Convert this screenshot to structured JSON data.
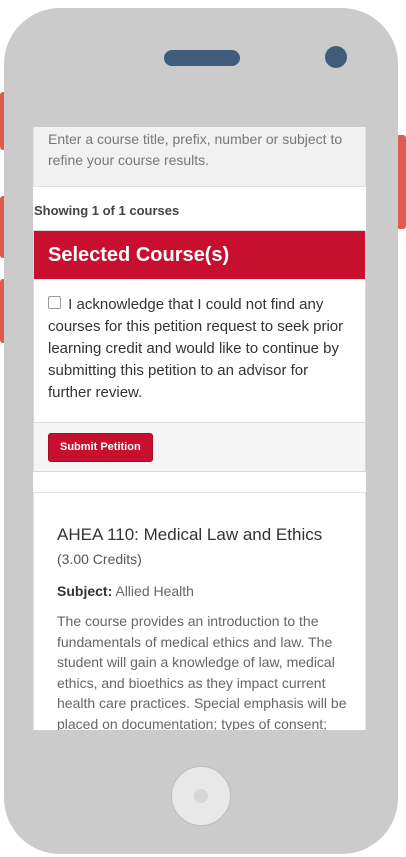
{
  "search": {
    "hint": "Enter a course title, prefix, number or subject to refine your course results."
  },
  "results": {
    "showing_text": "Showing 1 of 1 courses"
  },
  "selected_panel": {
    "title": "Selected Course(s)",
    "acknowledge_text": "I acknowledge that I could not find any courses for this petition request to seek prior learning credit and would like to continue by submitting this petition to an advisor for further review.",
    "acknowledge_checked": false,
    "submit_label": "Submit Petition"
  },
  "course": {
    "title": "AHEA 110: Medical Law and Ethics",
    "credits": "(3.00 Credits)",
    "subject_label": "Subject:",
    "subject_value": "Allied Health",
    "description": "The course provides an introduction to the fundamentals of medical ethics and law. The student will gain a knowledge of law, medical ethics, and bioethics as they impact current health care practices. Special emphasis will be placed on documentation; types of consent;"
  },
  "colors": {
    "accent": "#c8102e",
    "phone_body": "#cbcbcb",
    "side_buttons": "#e05a4f",
    "speaker": "#3f5c7a"
  },
  "icons": {
    "device_speaker": "speaker-grille",
    "device_camera": "front-camera",
    "device_home": "home-button"
  }
}
